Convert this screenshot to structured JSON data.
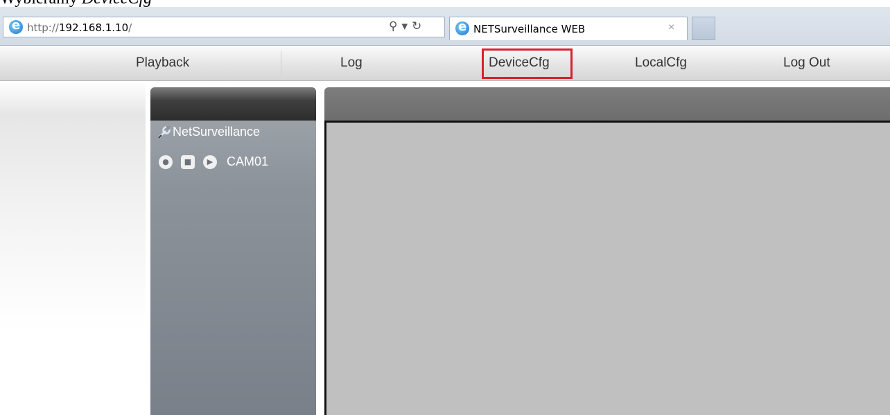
{
  "caption": {
    "prefix": "Wybieramy ",
    "emph": "DeviceCfg"
  },
  "browser": {
    "url_scheme": "http://",
    "url_host": "192.168.1.10",
    "url_tail": "/",
    "search_glyph": "⚲",
    "dropdown_glyph": "▾",
    "refresh_glyph": "↻",
    "tab_title": "NETSurveillance WEB",
    "tab_close_glyph": "×"
  },
  "nav": {
    "playback": "Playback",
    "log": "Log",
    "devicecfg": "DeviceCfg",
    "localcfg": "LocalCfg",
    "logout": "Log Out"
  },
  "highlight_color": "#d8212f",
  "tree": {
    "root_label": "NetSurveillance",
    "camera_label": "CAM01",
    "icons": [
      "wrench-icon",
      "record-icon",
      "stop-square-icon",
      "play-icon"
    ]
  }
}
